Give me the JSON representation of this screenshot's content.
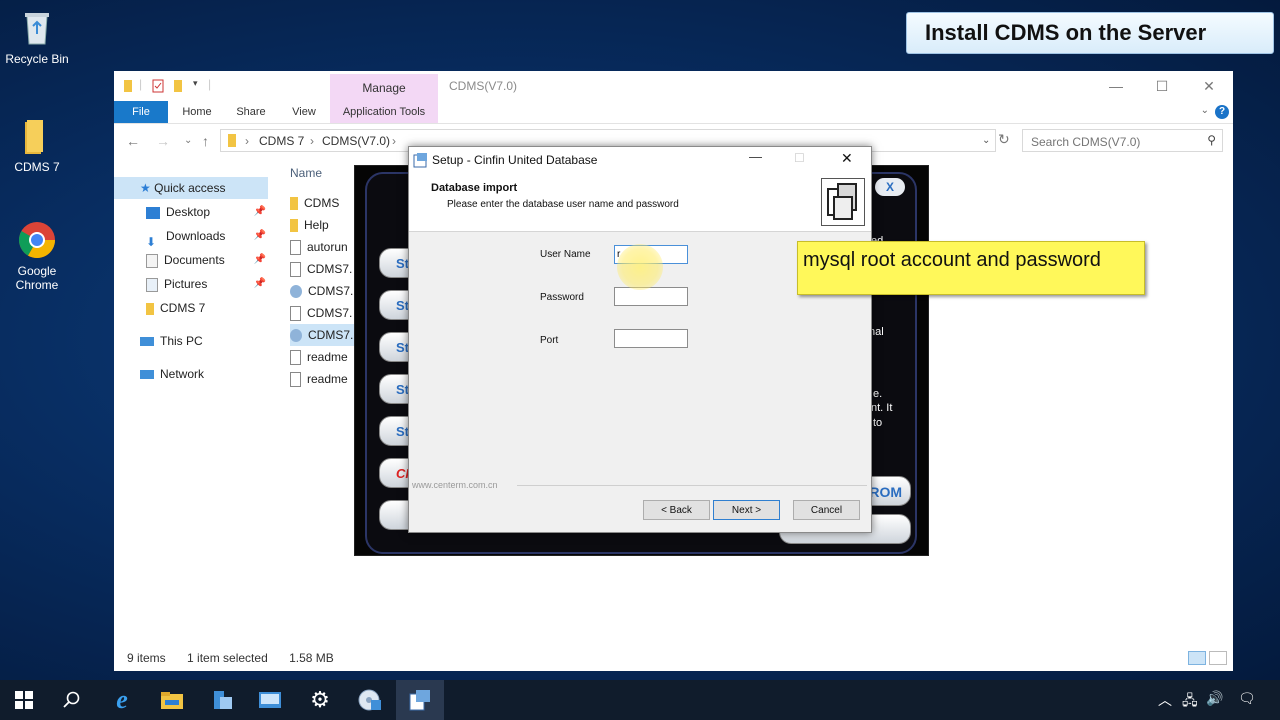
{
  "banner": "Install CDMS on the Server",
  "desktop_icons": [
    {
      "label": "Recycle Bin",
      "icon": "recycle-bin-icon"
    },
    {
      "label": "CDMS 7",
      "icon": "folder-icon"
    },
    {
      "label": "Google\nChrome",
      "label_line1": "Google",
      "label_line2": "Chrome",
      "icon": "chrome-icon"
    }
  ],
  "explorer": {
    "title": "CDMS(V7.0)",
    "manage_tab": "Manage",
    "ribbon_tabs": [
      "File",
      "Home",
      "Share",
      "View",
      "Application Tools"
    ],
    "breadcrumb": [
      "CDMS 7",
      "CDMS(V7.0)"
    ],
    "search_placeholder": "Search CDMS(V7.0)",
    "nav": {
      "quick_access": "Quick access",
      "items": [
        "Desktop",
        "Downloads",
        "Documents",
        "Pictures",
        "CDMS 7"
      ],
      "this_pc": "This PC",
      "network": "Network"
    },
    "column_name": "Name",
    "files": [
      "CDMS",
      "Help",
      "autorun",
      "CDMS7.",
      "CDMS7.",
      "CDMS7.",
      "CDMS7.",
      "readme",
      "readme"
    ],
    "status": {
      "items": "9 items",
      "selected": "1 item selected",
      "size": "1.58 MB"
    }
  },
  "app_panel": {
    "step_buttons": [
      "Ste",
      "Ste",
      "Ste",
      "Ste",
      "Ste",
      "CPS",
      ""
    ],
    "right_text": [
      "ed",
      "nal",
      "e.",
      "nt. It",
      "to"
    ],
    "cdrom_button": "ROM"
  },
  "setup": {
    "title": "Setup - Cinfin United Database",
    "header_title": "Database import",
    "header_sub": "Please enter the database user name and password",
    "fields": {
      "username_label": "User Name",
      "username_value": "r",
      "password_label": "Password",
      "password_value": "",
      "port_label": "Port",
      "port_value": ""
    },
    "watermark": "www.centerm.com.cn",
    "buttons": {
      "back": "< Back",
      "next": "Next >",
      "cancel": "Cancel"
    }
  },
  "callout": "mysql root account and password",
  "colors": {
    "accent": "#1979ca",
    "manage": "#f3d8f5",
    "callout": "#fff85a",
    "taskbar": "#101c2c"
  }
}
